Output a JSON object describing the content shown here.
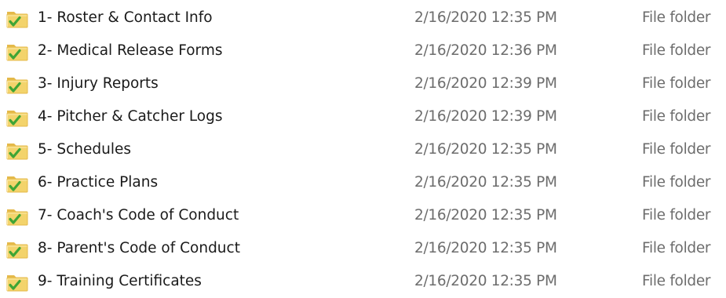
{
  "colors": {
    "folder_body": "#F3D36B",
    "folder_tab": "#E4B94A",
    "check_mark": "#3FA535",
    "name_text": "#1A1A1A",
    "meta_text": "#6D6D6D"
  },
  "icon": "folder-with-green-check-icon",
  "files": [
    {
      "name": "1- Roster & Contact Info",
      "date_modified": "2/16/2020 12:35 PM",
      "type": "File folder"
    },
    {
      "name": "2- Medical Release Forms",
      "date_modified": "2/16/2020 12:36 PM",
      "type": "File folder"
    },
    {
      "name": "3- Injury Reports",
      "date_modified": "2/16/2020 12:39 PM",
      "type": "File folder"
    },
    {
      "name": "4- Pitcher & Catcher Logs",
      "date_modified": "2/16/2020 12:39 PM",
      "type": "File folder"
    },
    {
      "name": "5- Schedules",
      "date_modified": "2/16/2020 12:35 PM",
      "type": "File folder"
    },
    {
      "name": "6- Practice Plans",
      "date_modified": "2/16/2020 12:35 PM",
      "type": "File folder"
    },
    {
      "name": "7- Coach's Code of Conduct",
      "date_modified": "2/16/2020 12:35 PM",
      "type": "File folder"
    },
    {
      "name": "8- Parent's Code of Conduct",
      "date_modified": "2/16/2020 12:35 PM",
      "type": "File folder"
    },
    {
      "name": "9- Training Certificates",
      "date_modified": "2/16/2020 12:35 PM",
      "type": "File folder"
    }
  ]
}
